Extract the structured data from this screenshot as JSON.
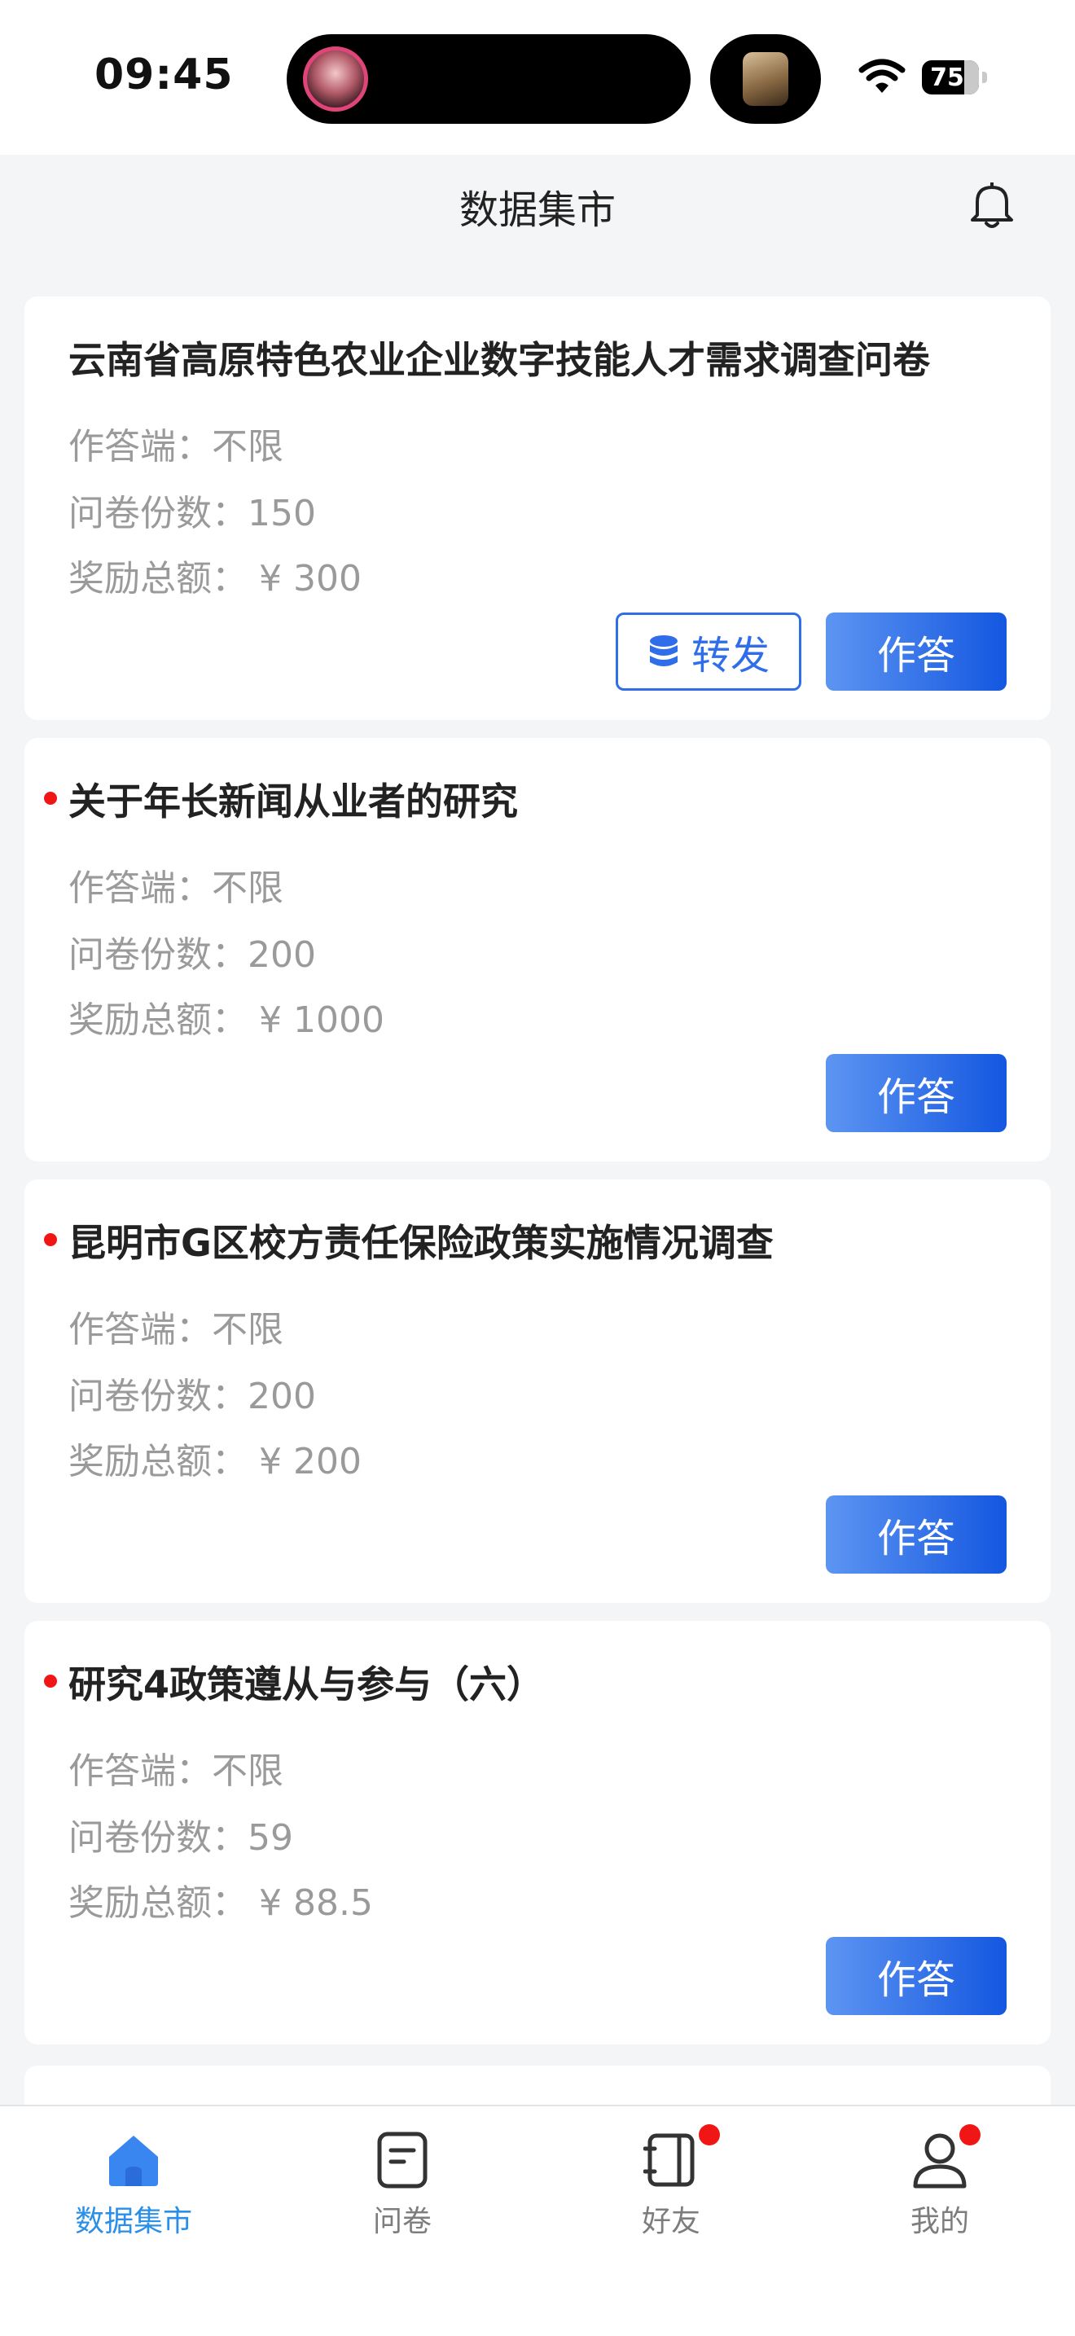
{
  "status_bar": {
    "time": "09:45",
    "battery": "75"
  },
  "header": {
    "title": "数据集市"
  },
  "cards": [
    {
      "title": "云南省高原特色农业企业数字技能人才需求调查问卷",
      "answer_side": "作答端：不限",
      "count": "问卷份数：150",
      "reward": "奖励总额：  ¥ 300",
      "share_label": "转发",
      "answer_label": "作答"
    },
    {
      "title": "关于年长新闻从业者的研究",
      "answer_side": "作答端：不限",
      "count": "问卷份数：200",
      "reward": "奖励总额：  ¥ 1000",
      "answer_label": "作答"
    },
    {
      "title": "昆明市G区校方责任保险政策实施情况调查",
      "answer_side": "作答端：不限",
      "count": "问卷份数：200",
      "reward": "奖励总额：  ¥ 200",
      "answer_label": "作答"
    },
    {
      "title": "研究4政策遵从与参与（六）",
      "answer_side": "作答端：不限",
      "count": "问卷份数：59",
      "reward": "奖励总额：  ¥ 88.5",
      "answer_label": "作答"
    }
  ],
  "tabbar": {
    "items": [
      {
        "label": "数据集市",
        "icon": "home-icon"
      },
      {
        "label": "问卷",
        "icon": "document-icon"
      },
      {
        "label": "好友",
        "icon": "notebook-icon"
      },
      {
        "label": "我的",
        "icon": "user-icon"
      }
    ]
  },
  "colors": {
    "accent": "#2f6ee8",
    "active_tab": "#2a8fe8",
    "badge": "#f01616"
  }
}
